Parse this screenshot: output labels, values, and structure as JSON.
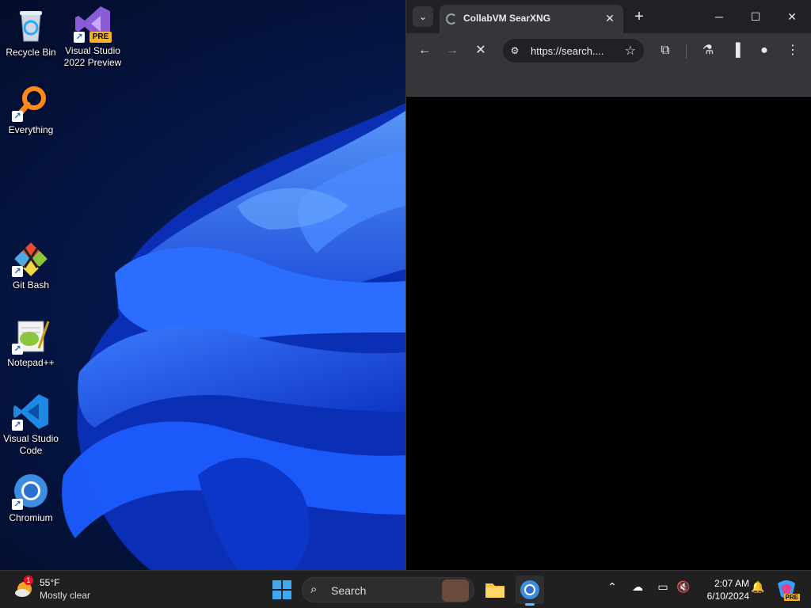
{
  "desktop": {
    "icons": [
      {
        "label": "Recycle Bin",
        "icon": "recycle-bin-icon"
      },
      {
        "label": "Visual Studio 2022 Preview",
        "icon": "visual-studio-icon",
        "badge": "PRE"
      },
      {
        "label": "Everything",
        "icon": "everything-icon"
      },
      {
        "label": "Git Bash",
        "icon": "git-bash-icon"
      },
      {
        "label": "Notepad++",
        "icon": "notepad-plus-plus-icon"
      },
      {
        "label": "Visual Studio Code",
        "icon": "vscode-icon"
      },
      {
        "label": "Chromium",
        "icon": "chromium-icon"
      }
    ]
  },
  "browser": {
    "tab_title": "CollabVM SearXNG",
    "address": "https://search...."
  },
  "taskbar": {
    "weather_temp": "55°F",
    "weather_desc": "Mostly clear",
    "weather_badge": "1",
    "search_label": "Search",
    "time": "2:07 AM",
    "date": "6/10/2024",
    "copilot_badge": "PRE"
  }
}
